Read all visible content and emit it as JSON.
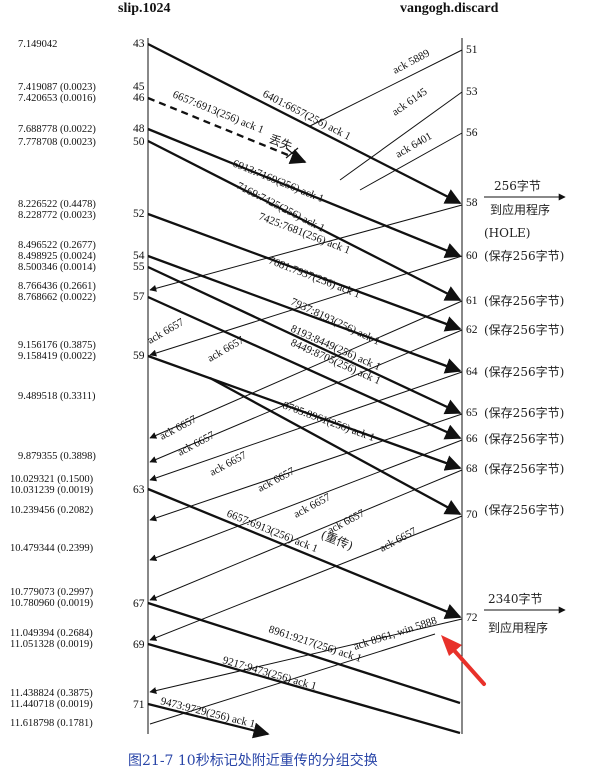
{
  "hosts": {
    "left": "slip.1024",
    "right": "vangogh.discard"
  },
  "timestamps": [
    "7.149042",
    "7.419087 (0.0023)",
    "7.420653 (0.0016)",
    "7.688778 (0.0022)",
    "7.778708 (0.0023)",
    "8.226522 (0.4478)",
    "8.228772 (0.0023)",
    "8.496522 (0.2677)",
    "8.498925 (0.0024)",
    "8.500346 (0.0014)",
    "8.766436 (0.2661)",
    "8.768662 (0.0022)",
    "9.156176 (0.3875)",
    "9.158419 (0.0022)",
    "9.489518 (0.3311)",
    "9.879355 (0.3898)",
    "10.029321 (0.1500)",
    "10.031239 (0.0019)",
    "10.239456 (0.2082)",
    "10.479344 (0.2399)",
    "10.779073 (0.2997)",
    "10.780960 (0.0019)",
    "11.049394 (0.2684)",
    "11.051328 (0.0019)",
    "11.438824 (0.3875)",
    "11.440718 (0.0019)",
    "11.618798 (0.1781)"
  ],
  "left_numbers": [
    "43",
    "45",
    "46",
    "48",
    "50",
    "52",
    "54",
    "55",
    "57",
    "59",
    "63",
    "67",
    "69",
    "71"
  ],
  "right_numbers": [
    "51",
    "53",
    "56",
    "58",
    "60",
    "61",
    "62",
    "64",
    "65",
    "66",
    "68",
    "70",
    "72"
  ],
  "segments": {
    "s43": "6401:6657(256) ack 1",
    "s45": "6657:6913(256) ack 1",
    "lost": "丢失",
    "s48": "6913:7169(256) ack 1",
    "s50": "7169:7425(256) ack 1",
    "s52": "7425:7681(256) ack 1",
    "s54": "7681:7937(256) ack 1",
    "s55": "7937:8193(256) ack 1",
    "s57a": "8193:8449(256) ack 1",
    "s57b": "8449:8705(256) ack 1",
    "s59": "8705:8961(256) ack 1",
    "s63": "6657:6913(256) ack 1",
    "retrans": "(重传)",
    "s67": "8961:9217(256) ack 1",
    "s69": "9217:9473(256) ack 1",
    "s71": "9473:9729(256) ack 1"
  },
  "acks": {
    "a51": "ack 5889",
    "a53": "ack 6145",
    "a56": "ack 6401",
    "a6657": "ack 6657",
    "a72": "ack 8961, win 5888"
  },
  "annotations": {
    "deliver1_bytes": "256字节",
    "deliver1_dest": "到应用程序",
    "hole": "(HOLE)",
    "saved": "(保存256字节)",
    "deliver2_bytes": "2340字节",
    "deliver2_dest": "到应用程序"
  },
  "caption": "图21-7   10秒标记处附近重传的分组交换",
  "colors": {
    "caption": "#2a46a8",
    "highlight_arrow": "#e8312a"
  }
}
